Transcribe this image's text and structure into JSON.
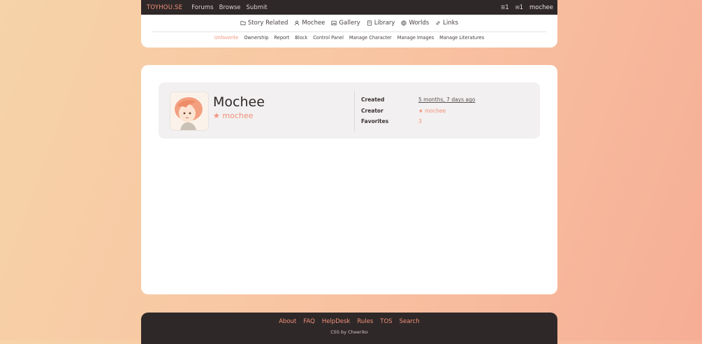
{
  "topbar": {
    "brand": "TOYHOU.SE",
    "nav": [
      "Forums",
      "Browse",
      "Submit"
    ],
    "notifications": "1",
    "messages": "1",
    "username": "mochee"
  },
  "character_nav": {
    "items": [
      {
        "label": "Story Related",
        "icon": "folder-icon"
      },
      {
        "label": "Mochee",
        "icon": "user-icon"
      },
      {
        "label": "Gallery",
        "icon": "image-icon"
      },
      {
        "label": "Library",
        "icon": "book-icon"
      },
      {
        "label": "Worlds",
        "icon": "globe-icon"
      },
      {
        "label": "Links",
        "icon": "link-icon"
      }
    ],
    "actions": [
      "Unfavorite",
      "Ownership",
      "Report",
      "Block",
      "Control Panel",
      "Manage Character",
      "Manage Images",
      "Manage Literatures"
    ]
  },
  "profile": {
    "name": "Mochee",
    "owner": "mochee",
    "created_label": "Created",
    "created_value": "5 months, 7 days ago",
    "creator_label": "Creator",
    "creator_value": "mochee",
    "favorites_label": "Favorites",
    "favorites_value": "3"
  },
  "footer": {
    "links": [
      "About",
      "FAQ",
      "HelpDesk",
      "Rules",
      "TOS",
      "Search"
    ],
    "credit": "CSS by Cheeriko"
  },
  "colors": {
    "accent": "#f1907a",
    "dark": "#2f2828"
  }
}
